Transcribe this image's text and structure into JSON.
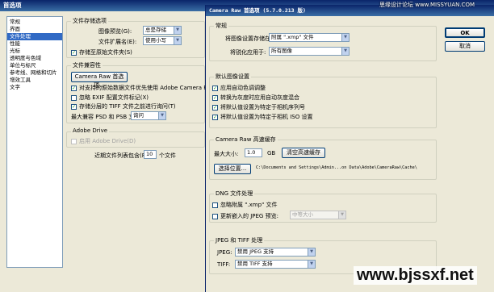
{
  "watermark_top": "思缘设计论坛 www.MISSYUAN.COM",
  "watermark_bottom": "www.bjssxf.net",
  "prefs": {
    "title": "首选项",
    "sidebar": [
      "常规",
      "界面",
      "文件处理",
      "性能",
      "光标",
      "透明度与色域",
      "单位与标尺",
      "参考线、网格和切片",
      "增效工具",
      "文字"
    ],
    "save_group": "文件存储选项",
    "image_preview_label": "图像预览(G):",
    "image_preview_value": "总是存储",
    "ext_label": "文件扩展名(E):",
    "ext_value": "使用小写",
    "save_as_original": "存储至原始文件夹(S)",
    "compat_group": "文件兼容性",
    "camera_raw_btn": "Camera Raw 首选项...",
    "chk_raw": "对支持的原始数据文件优先使用 Adobe Camera Raw(C)",
    "chk_exif": "忽略 EXIF 配置文件标记(X)",
    "chk_tiff": "存储分层的 TIFF 文件之前进行询问(T)",
    "psd_label": "最大兼容 PSD 和 PSB 文件(M):",
    "psd_value": "询问",
    "drive_group": "Adobe Drive",
    "drive_chk": "启用 Adobe Drive(D)",
    "recent_label": "近期文件列表包含(R):",
    "recent_value": "10",
    "recent_unit": "个文件"
  },
  "camera_raw": {
    "title": "Camera Raw 首选项  (5.7.0.213 版)",
    "ok": "OK",
    "cancel": "取消",
    "general_label": "常规",
    "save_settings_label": "将图像设置存储在:",
    "save_settings_value": "附属 \".xmp\" 文件",
    "sharpen_label": "将锐化应用于:",
    "sharpen_value": "所有图像",
    "defaults_label": "默认图像设置",
    "def1": "应用自动色调调整",
    "def2": "转换为灰度时应用自动灰度混合",
    "def3": "将默认值设置为特定于相机序列号",
    "def4": "将默认值设置为特定于相机 ISO 设置",
    "cache_label": "Camera Raw 高速缓存",
    "max_size_label": "最大大小:",
    "max_size_value": "1.0",
    "max_size_unit": "GB",
    "purge_btn": "清空高速缓存",
    "choose_btn": "选择位置...",
    "cache_path": "C:\\Documents and Settings\\Admin...on Data\\Adobe\\CameraRaw\\Cache\\",
    "dng_label": "DNG 文件处理",
    "dng1": "忽略附属 \".xmp\" 文件",
    "dng2": "更新嵌入的 JPEG 预览:",
    "dng2_value": "中等大小",
    "jt_label": "JPEG 和 TIFF 处理",
    "jpeg_label": "JPEG:",
    "jpeg_value": "禁用 JPEG 支持",
    "tiff_label": "TIFF:",
    "tiff_value": "禁用 TIFF 支持"
  }
}
